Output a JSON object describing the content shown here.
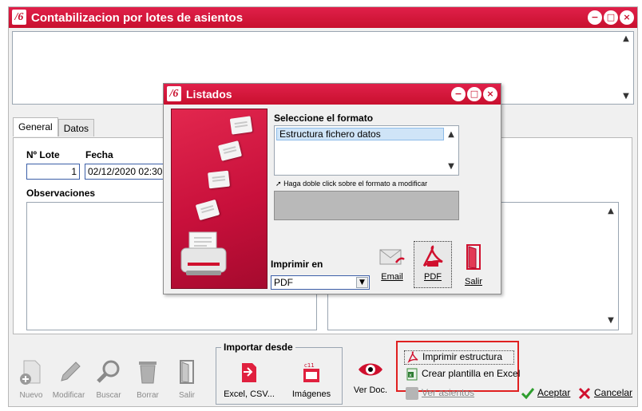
{
  "main_window": {
    "title": "Contabilizacion por lotes de asientos",
    "logo_text": "/6",
    "tabs": [
      {
        "label": "General"
      },
      {
        "label": "Datos"
      }
    ],
    "fields": {
      "lote_label": "Nº Lote",
      "lote_value": "1",
      "fecha_label": "Fecha",
      "fecha_value": "02/12/2020 02:30:0",
      "observaciones_label": "Observaciones"
    },
    "toolbar": {
      "nuevo": "Nuevo",
      "modificar": "Modificar",
      "buscar": "Buscar",
      "borrar": "Borrar",
      "salir": "Salir",
      "importar_label": "Importar desde",
      "excel_csv": "Excel, CSV...",
      "imagenes": "Imágenes",
      "ver_doc": "Ver Doc.",
      "imprimir_estructura": "Imprimir estructura",
      "crear_plantilla": "Crear plantilla en Excel",
      "ver_asientos": "Ver asientos",
      "aceptar": "Aceptar",
      "cancelar": "Cancelar"
    }
  },
  "dialog": {
    "title": "Listados",
    "logo_text": "/6",
    "seleccione_label": "Seleccione el formato",
    "formats": [
      "Estructura fichero datos"
    ],
    "hint": "Haga doble click sobre el formato a modificar",
    "imprimir_en_label": "Imprimir en",
    "imprimir_en_value": "PDF",
    "email": "Email",
    "pdf": "PDF",
    "salir": "Salir"
  },
  "colors": {
    "brand_red": "#c8102e",
    "highlight_red": "#e02020",
    "selection_blue": "#cfe4f7",
    "accept_green": "#2e9e2e"
  }
}
